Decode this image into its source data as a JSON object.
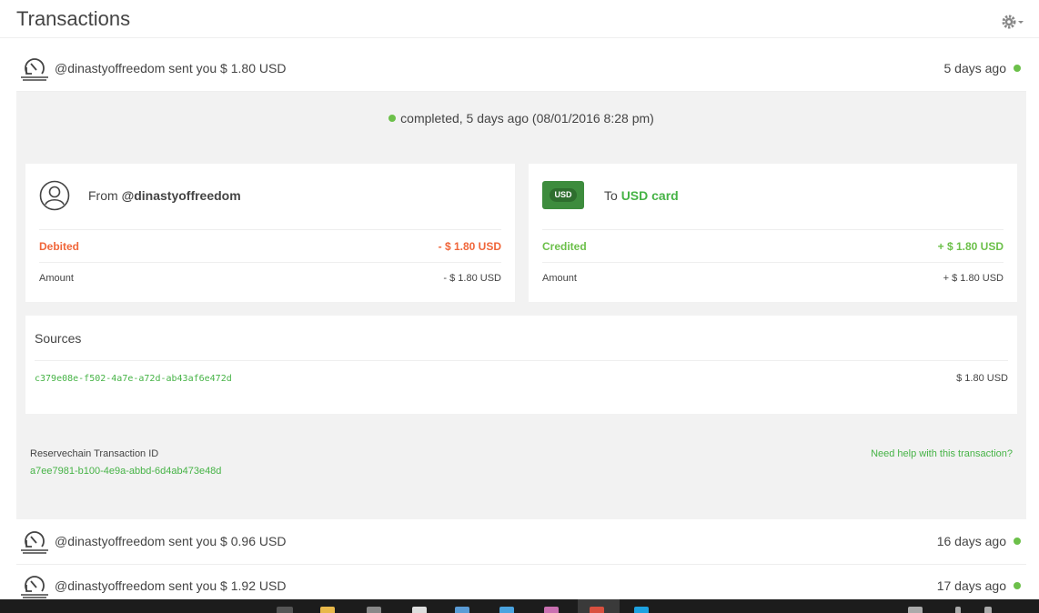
{
  "header": {
    "title": "Transactions",
    "settings_icon": "gear-icon"
  },
  "transactions": [
    {
      "text": "@dinastyoffreedom sent you $ 1.80 USD",
      "time": "5 days ago",
      "status_color": "#6cc04a",
      "icon": "transaction-arrow-icon"
    },
    {
      "text": "@dinastyoffreedom sent you $ 0.96 USD",
      "time": "16 days ago",
      "status_color": "#6cc04a",
      "icon": "transaction-arrow-icon"
    },
    {
      "text": "@dinastyoffreedom sent you $ 1.92 USD",
      "time": "17 days ago",
      "status_color": "#6cc04a",
      "icon": "transaction-arrow-icon"
    }
  ],
  "detail": {
    "status_text": "completed, 5 days ago (08/01/2016 8:28 pm)",
    "from": {
      "prefix": "From",
      "name": "@dinastyoffreedom",
      "row1_label": "Debited",
      "row1_value": "- $ 1.80 USD",
      "row2_label": "Amount",
      "row2_value": "- $ 1.80 USD"
    },
    "to": {
      "badge": "USD",
      "prefix": "To",
      "name": "USD card",
      "row1_label": "Credited",
      "row1_value": "+ $ 1.80 USD",
      "row2_label": "Amount",
      "row2_value": "+ $ 1.80 USD"
    },
    "sources": {
      "title": "Sources",
      "id": "c379e08e-f502-4a7e-a72d-ab43af6e472d",
      "amount": "$ 1.80 USD"
    },
    "reservechain_label": "Reservechain Transaction ID",
    "reservechain_id": "a7ee7981-b100-4e9a-abbd-6d4ab473e48d",
    "help_link": "Need help with this transaction?"
  },
  "colors": {
    "accent_green": "#46b346",
    "status_green": "#6cc04a",
    "debit_orange": "#f0663a"
  }
}
